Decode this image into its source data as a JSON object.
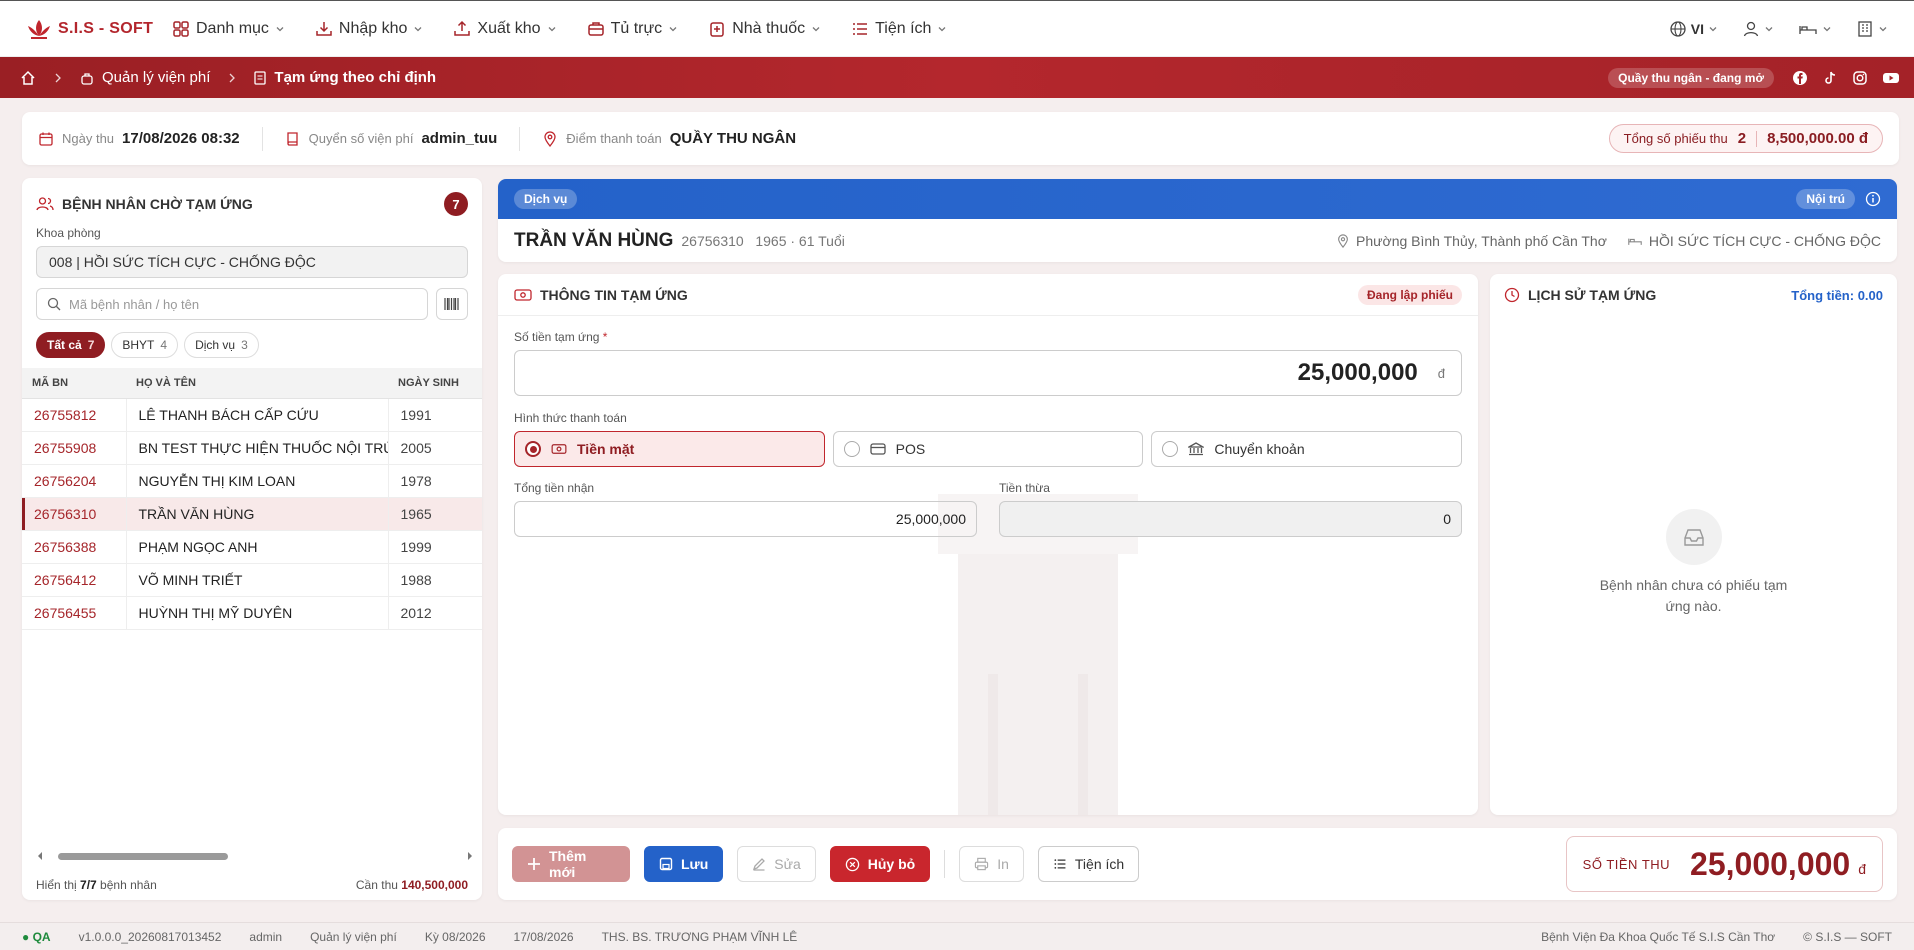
{
  "app": {
    "logo_text": "S.I.S - SOFT"
  },
  "menu": [
    {
      "label": "Danh mục",
      "icon": "grid-icon"
    },
    {
      "label": "Nhập kho",
      "icon": "import-icon"
    },
    {
      "label": "Xuất kho",
      "icon": "export-icon"
    },
    {
      "label": "Tủ trực",
      "icon": "cabinet-icon"
    },
    {
      "label": "Nhà thuốc",
      "icon": "pharmacy-icon"
    },
    {
      "label": "Tiện ích",
      "icon": "list-icon"
    }
  ],
  "topright": {
    "language": "VI"
  },
  "breadcrumb": {
    "module": "Quản lý viện phí",
    "page": "Tạm ứng theo chỉ định"
  },
  "cashier_status": "Quầy thu ngân - đang mở",
  "infobar": {
    "date_label": "Ngày thu",
    "date_value": "17/08/2026 08:32",
    "book_label": "Quyển số viện phí",
    "book_value": "admin_tuu",
    "point_label": "Điểm thanh toán",
    "point_value": "QUẦY THU NGÂN",
    "total_label": "Tổng số phiếu thu",
    "total_count": "2",
    "total_amount": "8,500,000.00 đ"
  },
  "waiting": {
    "title": "BỆNH NHÂN CHỜ TẠM ỨNG",
    "count": "7",
    "dept_label": "Khoa phòng",
    "dept_value": "008 | HỒI SỨC TÍCH CỰC - CHỐNG ĐỘC",
    "search_placeholder": "Mã bệnh nhân / họ tên",
    "tabs": [
      {
        "label": "Tất cả",
        "count": "7"
      },
      {
        "label": "BHYT",
        "count": "4"
      },
      {
        "label": "Dịch vụ",
        "count": "3"
      }
    ],
    "columns": [
      "MÃ BN",
      "HỌ VÀ TÊN",
      "NGÀY SINH"
    ],
    "rows": [
      {
        "id": "26755812",
        "name": "LÊ THANH BÁCH CẤP CỨU",
        "dob": "1991"
      },
      {
        "id": "26755908",
        "name": "BN TEST THỰC HIỆN THUỐC NỘI TRÚ",
        "dob": "2005"
      },
      {
        "id": "26756204",
        "name": "NGUYỄN THỊ KIM LOAN",
        "dob": "1978"
      },
      {
        "id": "26756310",
        "name": "TRẦN VĂN HÙNG",
        "dob": "1965"
      },
      {
        "id": "26756388",
        "name": "PHẠM NGỌC ANH",
        "dob": "1999"
      },
      {
        "id": "26756412",
        "name": "VÕ MINH TRIẾT",
        "dob": "1988"
      },
      {
        "id": "26756455",
        "name": "HUỲNH THỊ MỸ DUYÊN",
        "dob": "2012"
      }
    ],
    "selected_index": 3,
    "footer_prefix": "Hiển thị ",
    "footer_shown": "7/7",
    "footer_suffix": " bệnh nhân",
    "need_label": "Cần thu ",
    "need_value": "140,500,000"
  },
  "patient": {
    "type_badge": "Dịch vụ",
    "stay_badge": "Nội trú",
    "name": "TRẦN VĂN HÙNG",
    "meta": "26756310   1965 · 61 Tuổi",
    "address": "Phường Bình Thủy, Thành phố Cần Thơ",
    "department": "HỒI SỨC TÍCH CỰC - CHỐNG ĐỘC"
  },
  "advance": {
    "title": "THÔNG TIN TẠM ỨNG",
    "status": "Đang lập phiếu",
    "amount_label": "Số tiền tạm ứng",
    "required_mark": "*",
    "amount_value": "25,000,000",
    "currency": "đ",
    "method_label": "Hình thức thanh toán",
    "methods": [
      "Tiền mặt",
      "POS",
      "Chuyển khoản"
    ],
    "received_label": "Tổng tiền nhận",
    "received_value": "25,000,000",
    "change_label": "Tiền thừa",
    "change_value": "0"
  },
  "history": {
    "title": "LỊCH SỬ TẠM ỨNG",
    "total": "Tổng tiền: 0.00",
    "empty_text": "Bệnh nhân chưa có phiếu tạm ứng nào."
  },
  "actions": {
    "new": "Thêm mới",
    "save": "Lưu",
    "edit": "Sửa",
    "cancel": "Hủy bỏ",
    "print": "In",
    "utility": "Tiện ích",
    "total_label": "SỐ TIỀN THU",
    "total_value": "25,000,000",
    "total_currency": "đ"
  },
  "statusbar": {
    "env": "● QA",
    "version": "v1.0.0.0_20260817013452",
    "user": "admin",
    "module": "Quản lý viện phí",
    "period": "Kỳ 08/2026",
    "date": "17/08/2026",
    "doctor": "THS. BS. TRƯƠNG PHẠM VĨNH LÊ",
    "hospital": "Bệnh Viện Đa Khoa Quốc Tế S.I.S Cần Thơ",
    "copyright": "© S.I.S — SOFT"
  },
  "colors": {
    "brand": "#b3262d",
    "dark_brand": "#8f1d22",
    "accent_blue": "#2462c9"
  }
}
